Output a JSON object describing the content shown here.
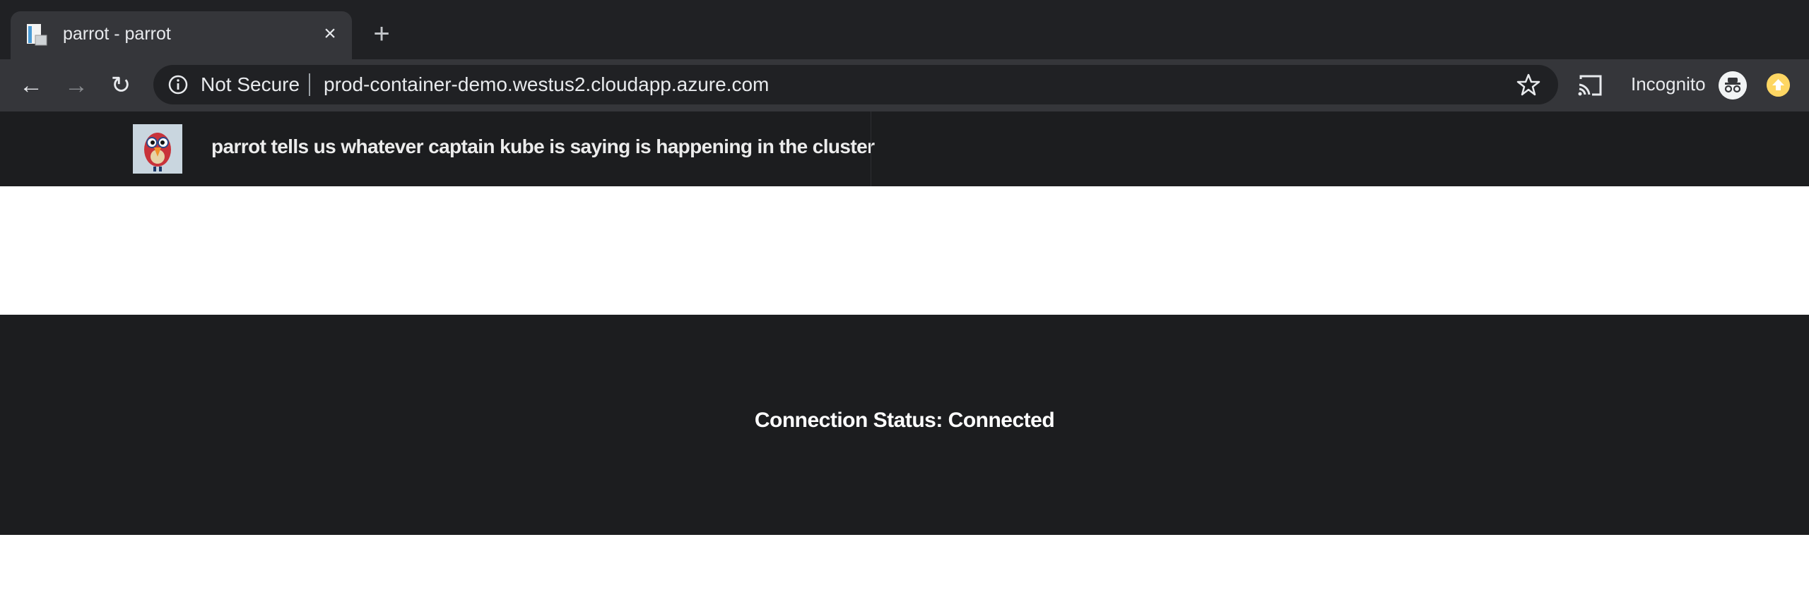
{
  "browser": {
    "tab": {
      "title": "parrot - parrot",
      "close_glyph": "×"
    },
    "new_tab_glyph": "+",
    "nav": {
      "back_glyph": "←",
      "forward_glyph": "→",
      "reload_glyph": "↻"
    },
    "omnibox": {
      "security_label": "Not Secure",
      "url": "prod-container-demo.westus2.cloudapp.azure.com"
    },
    "profile_label": "Incognito"
  },
  "app": {
    "header": {
      "title": "parrot tells us whatever captain kube is saying is happening in the cluster"
    },
    "status": {
      "text": "Connection Status: Connected"
    }
  },
  "colors": {
    "tabstrip": "#202124",
    "toolbar": "#35363a",
    "app_dark": "#1c1d1f",
    "update_badge": "#fdd663"
  }
}
